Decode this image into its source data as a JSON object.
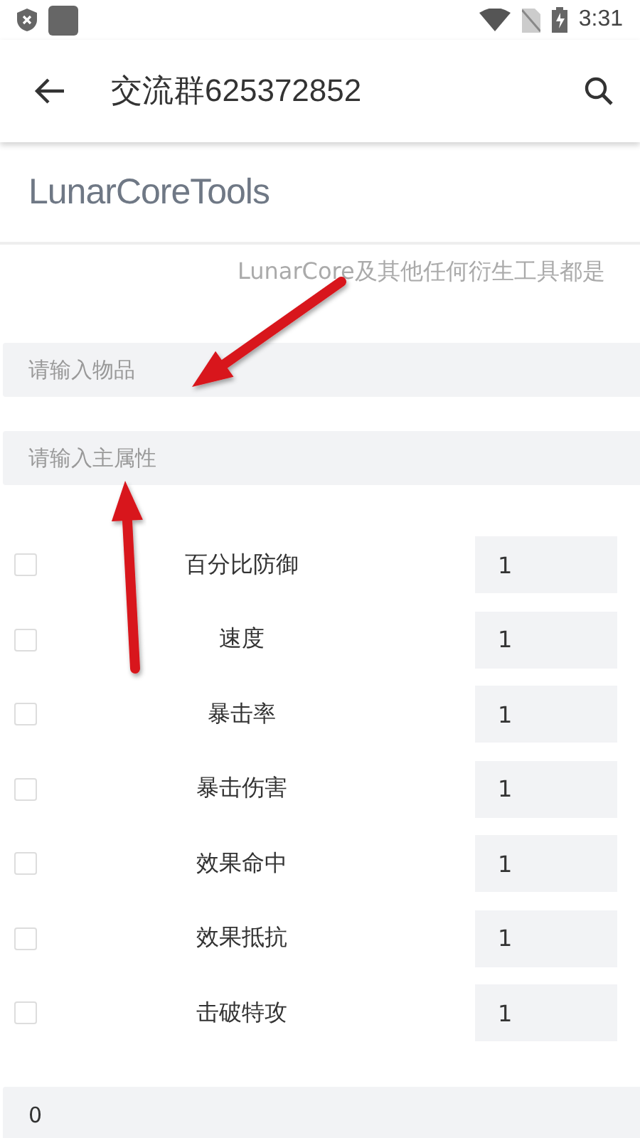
{
  "status_bar": {
    "time": "3:31"
  },
  "app_bar": {
    "title": "交流群625372852"
  },
  "header": {
    "title": "LunarCoreTools"
  },
  "notice": "LunarCore及其他任何衍生工具都是",
  "fields": [
    {
      "placeholder": "请输入物品"
    },
    {
      "placeholder": "请输入主属性"
    }
  ],
  "stats": [
    {
      "label": "百分比防御",
      "checked": false,
      "value": "1"
    },
    {
      "label": "速度",
      "checked": false,
      "value": "1"
    },
    {
      "label": "暴击率",
      "checked": false,
      "value": "1"
    },
    {
      "label": "暴击伤害",
      "checked": false,
      "value": "1"
    },
    {
      "label": "效果命中",
      "checked": false,
      "value": "1"
    },
    {
      "label": "效果抵抗",
      "checked": false,
      "value": "1"
    },
    {
      "label": "击破特攻",
      "checked": false,
      "value": "1"
    }
  ],
  "bottom_field": {
    "value": "0"
  },
  "annotations": [
    {
      "kind": "arrow"
    },
    {
      "kind": "arrow"
    }
  ]
}
